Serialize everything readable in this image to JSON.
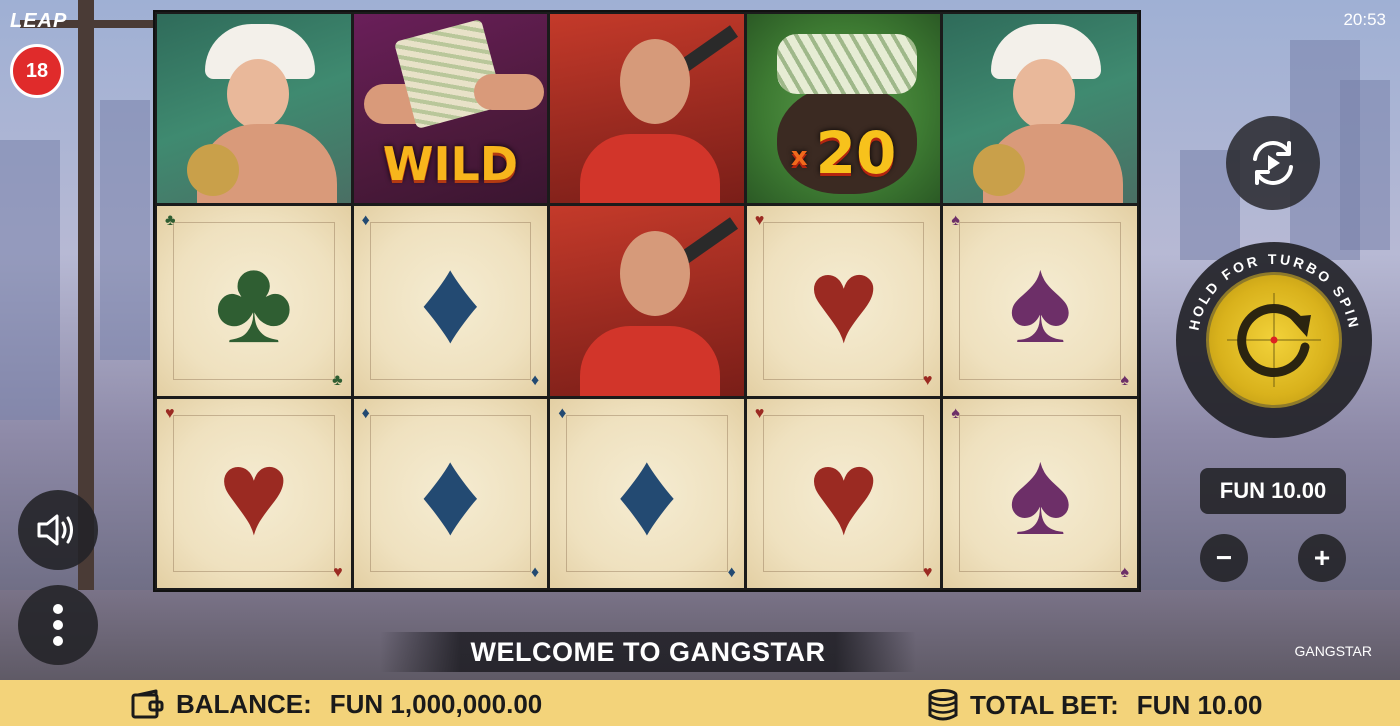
{
  "header": {
    "logo": "LEAP",
    "clock": "20:53",
    "age_rating": "18"
  },
  "reels": {
    "grid": [
      [
        "woman",
        "wild",
        "gangster",
        "moneybag",
        "woman"
      ],
      [
        "club",
        "diamond",
        "gangster",
        "heart",
        "spade"
      ],
      [
        "heart",
        "diamond",
        "diamond",
        "heart",
        "spade"
      ]
    ],
    "wild_label": "WILD",
    "multiplier_prefix": "x",
    "multiplier_value": "20"
  },
  "controls": {
    "turbo_hint": "HOLD FOR TURBO SPIN",
    "bet_value": "FUN 10.00",
    "decrease_label": "−",
    "increase_label": "+"
  },
  "message": "WELCOME TO GANGSTAR",
  "game_name": "GANGSTAR",
  "footer": {
    "balance_label": "BALANCE:",
    "balance_value": "FUN 1,000,000.00",
    "total_bet_label": "TOTAL BET:",
    "total_bet_value": "FUN 10.00"
  },
  "colors": {
    "footer_bg": "#f3d37a",
    "spin_button": "#e2c02a",
    "age_badge": "#e02b2b"
  }
}
